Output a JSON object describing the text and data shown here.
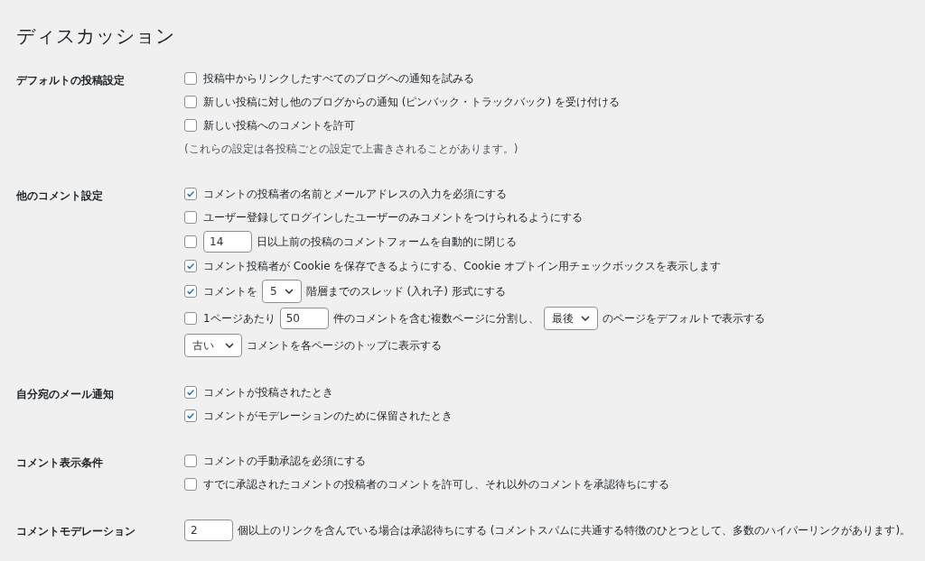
{
  "page_title": "ディスカッション",
  "sections": [
    {
      "label": "デフォルトの投稿設定",
      "rows": [
        {
          "kind": "check",
          "checked": false,
          "parts": [
            {
              "kind": "text",
              "text": "投稿中からリンクしたすべてのブログへの通知を試みる"
            }
          ]
        },
        {
          "kind": "check",
          "checked": false,
          "parts": [
            {
              "kind": "text",
              "text": "新しい投稿に対し他のブログからの通知 (ピンバック・トラックバック) を受け付ける"
            }
          ]
        },
        {
          "kind": "check",
          "checked": false,
          "parts": [
            {
              "kind": "text",
              "text": "新しい投稿へのコメントを許可"
            }
          ]
        },
        {
          "kind": "note",
          "parts": [
            {
              "kind": "text",
              "text": "(これらの設定は各投稿ごとの設定で上書きされることがあります。)"
            }
          ]
        }
      ]
    },
    {
      "label": "他のコメント設定",
      "rows": [
        {
          "kind": "check",
          "checked": true,
          "parts": [
            {
              "kind": "text",
              "text": "コメントの投稿者の名前とメールアドレスの入力を必須にする"
            }
          ]
        },
        {
          "kind": "check",
          "checked": false,
          "parts": [
            {
              "kind": "text",
              "text": "ユーザー登録してログインしたユーザーのみコメントをつけられるようにする"
            }
          ]
        },
        {
          "kind": "check",
          "checked": false,
          "parts": [
            {
              "kind": "input",
              "value": "14"
            },
            {
              "kind": "text",
              "text": "日以上前の投稿のコメントフォームを自動的に閉じる"
            }
          ]
        },
        {
          "kind": "check",
          "checked": true,
          "parts": [
            {
              "kind": "text",
              "text": "コメント投稿者が Cookie を保存できるようにする、Cookie オプトイン用チェックボックスを表示します"
            }
          ]
        },
        {
          "kind": "check",
          "checked": true,
          "parts": [
            {
              "kind": "text",
              "text": "コメントを"
            },
            {
              "kind": "select",
              "value": "5"
            },
            {
              "kind": "text",
              "text": "階層までのスレッド (入れ子) 形式にする"
            }
          ]
        },
        {
          "kind": "check",
          "checked": false,
          "parts": [
            {
              "kind": "text",
              "text": "1ページあたり"
            },
            {
              "kind": "input",
              "value": "50"
            },
            {
              "kind": "text",
              "text": "件のコメントを含む複数ページに分割し、"
            },
            {
              "kind": "select",
              "value": "最後"
            },
            {
              "kind": "text",
              "text": "のページをデフォルトで表示する"
            }
          ]
        },
        {
          "kind": "plain",
          "parts": [
            {
              "kind": "select",
              "value": "古い"
            },
            {
              "kind": "text",
              "text": "コメントを各ページのトップに表示する"
            }
          ]
        }
      ]
    },
    {
      "label": "自分宛のメール通知",
      "rows": [
        {
          "kind": "check",
          "checked": true,
          "parts": [
            {
              "kind": "text",
              "text": "コメントが投稿されたとき"
            }
          ]
        },
        {
          "kind": "check",
          "checked": true,
          "parts": [
            {
              "kind": "text",
              "text": "コメントがモデレーションのために保留されたとき"
            }
          ]
        }
      ]
    },
    {
      "label": "コメント表示条件",
      "rows": [
        {
          "kind": "check",
          "checked": false,
          "parts": [
            {
              "kind": "text",
              "text": "コメントの手動承認を必須にする"
            }
          ]
        },
        {
          "kind": "check",
          "checked": false,
          "parts": [
            {
              "kind": "text",
              "text": "すでに承認されたコメントの投稿者のコメントを許可し、それ以外のコメントを承認待ちにする"
            }
          ]
        }
      ]
    },
    {
      "label": "コメントモデレーション",
      "rows": [
        {
          "kind": "plain",
          "parts": [
            {
              "kind": "input",
              "value": "2"
            },
            {
              "kind": "text",
              "text": "個以上のリンクを含んでいる場合は承認待ちにする (コメントスパムに共通する特徴のひとつとして、多数のハイパーリンクがあります)。"
            }
          ]
        }
      ]
    }
  ]
}
